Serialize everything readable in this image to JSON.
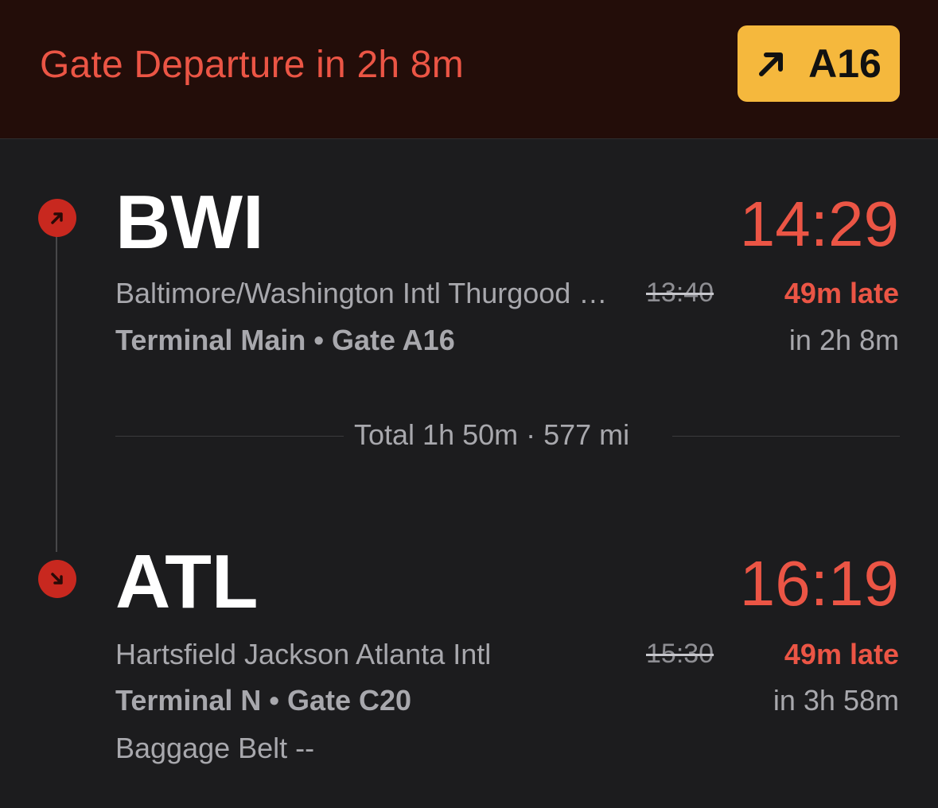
{
  "banner": {
    "title": "Gate Departure in 2h 8m",
    "gate_label": "A16",
    "gate_icon": "arrow-up-right-icon"
  },
  "departure": {
    "code": "BWI",
    "time": "14:29",
    "airport_name": "Baltimore/Washington Intl Thurgood Marshall",
    "terminal": "Terminal Main • Gate A16",
    "scheduled": "13:40",
    "late": "49m late",
    "relative": "in 2h 8m",
    "icon": "departure-arrow-icon"
  },
  "summary": {
    "total": "Total 1h 50m · 577 mi"
  },
  "arrival": {
    "code": "ATL",
    "time": "16:19",
    "airport_name": "Hartsfield Jackson Atlanta Intl",
    "terminal": "Terminal N • Gate C20",
    "scheduled": "15:30",
    "late": "49m late",
    "relative": "in 3h 58m",
    "baggage": "Baggage Belt --",
    "icon": "arrival-arrow-icon"
  },
  "colors": {
    "accent_red": "#eb5545",
    "gate_yellow": "#f5b83d",
    "background": "#1c1c1e",
    "banner_background": "#230d09"
  }
}
